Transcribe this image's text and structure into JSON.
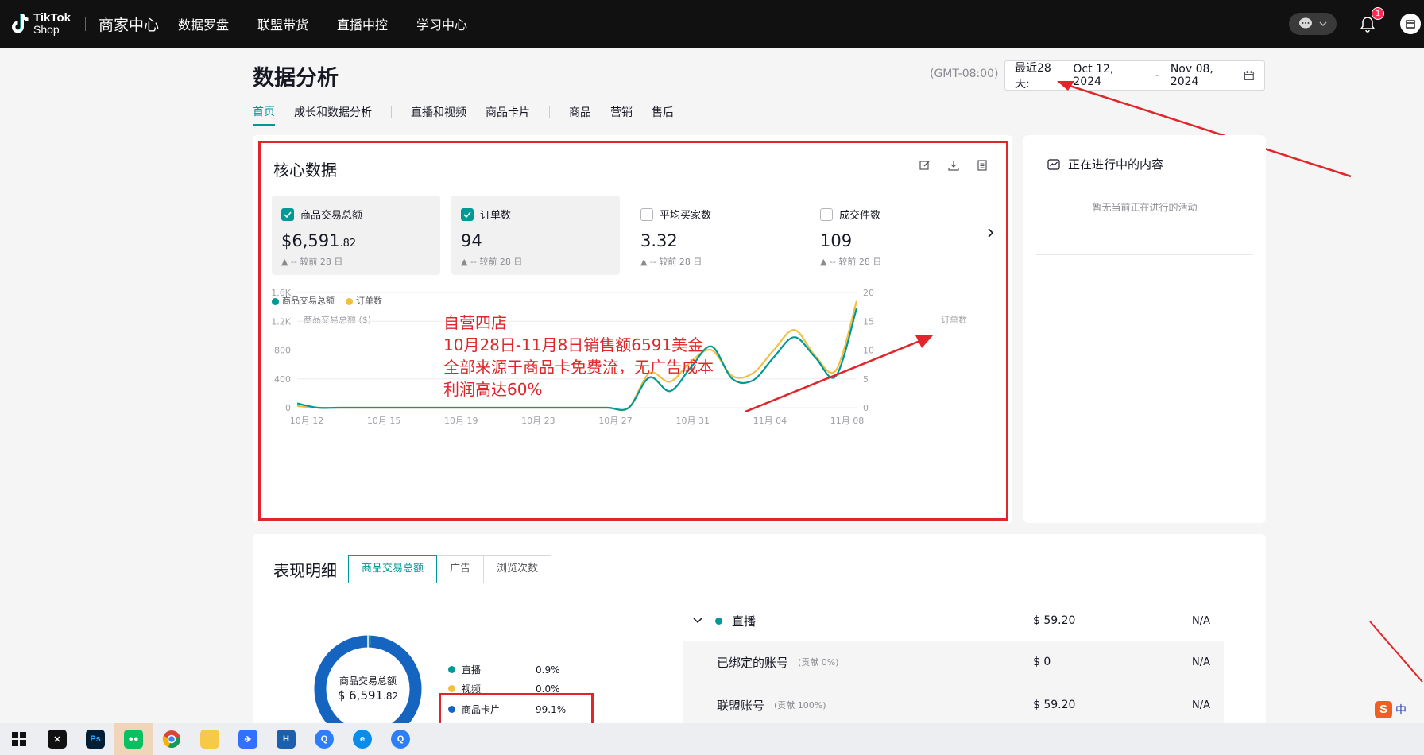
{
  "topbar": {
    "logo_line1": "TikTok",
    "logo_line2": "Shop",
    "title": "商家中心",
    "nav": [
      "数据罗盘",
      "联盟带货",
      "直播中控",
      "学习中心"
    ],
    "notification_count": "1"
  },
  "header": {
    "title": "数据分析",
    "timezone": "(GMT-08:00)",
    "range_label": "最近28天:",
    "date_start": "Oct 12, 2024",
    "date_end": "Nov 08, 2024",
    "date_dash": "-"
  },
  "tabs": [
    "首页",
    "成长和数据分析",
    "直播和视频",
    "商品卡片",
    "商品",
    "营销",
    "售后"
  ],
  "core": {
    "title": "核心数据",
    "metrics": [
      {
        "label": "商品交易总额",
        "prefix": "$",
        "value": "6,591",
        "decimals": ".82",
        "compare": "▲ -- 较前 28 日",
        "checked": true
      },
      {
        "label": "订单数",
        "prefix": "",
        "value": "94",
        "decimals": "",
        "compare": "▲ -- 较前 28 日",
        "checked": true
      },
      {
        "label": "平均买家数",
        "prefix": "",
        "value": "3.32",
        "decimals": "",
        "compare": "▲ -- 较前 28 日",
        "checked": false
      },
      {
        "label": "成交件数",
        "prefix": "",
        "value": "109",
        "decimals": "",
        "compare": "▲ -- 较前 28 日",
        "checked": false
      }
    ],
    "legend": [
      "商品交易总额",
      "订单数"
    ],
    "left_axis_name": "商品交易总额 ($)",
    "right_axis_name": "订单数"
  },
  "annotation": {
    "lines": [
      "自营四店",
      "10月28日-11月8日销售额6591美金",
      "全部来源于商品卡免费流，无广告成本",
      "利润高达60%"
    ]
  },
  "chart_data": {
    "type": "line",
    "x_ticks": [
      "10月 12",
      "10月 15",
      "10月 19",
      "10月 23",
      "10月 27",
      "10月 31",
      "11月 04",
      "11月 08"
    ],
    "y_left_ticks": [
      "0",
      "400",
      "800",
      "1.2K",
      "1.6K"
    ],
    "y_right_ticks": [
      "0",
      "5",
      "10",
      "15",
      "20"
    ],
    "ylim_left": [
      0,
      1600
    ],
    "ylim_right": [
      0,
      20
    ],
    "x_dates": [
      "10-12",
      "10-13",
      "10-14",
      "10-15",
      "10-16",
      "10-17",
      "10-18",
      "10-19",
      "10-20",
      "10-21",
      "10-22",
      "10-23",
      "10-24",
      "10-25",
      "10-26",
      "10-27",
      "10-28",
      "10-29",
      "10-30",
      "10-31",
      "11-01",
      "11-02",
      "11-03",
      "11-04",
      "11-05",
      "11-06",
      "11-07",
      "11-08"
    ],
    "series": [
      {
        "name": "商品交易总额",
        "axis": "left",
        "color": "#009995",
        "values": [
          60,
          0,
          0,
          0,
          0,
          0,
          0,
          0,
          0,
          0,
          0,
          0,
          0,
          0,
          0,
          0,
          0,
          420,
          230,
          560,
          850,
          400,
          380,
          700,
          980,
          700,
          440,
          1380
        ]
      },
      {
        "name": "订单数",
        "axis": "right",
        "color": "#f0c040",
        "values": [
          0.3,
          0,
          0,
          0,
          0,
          0,
          0,
          0,
          0,
          0,
          0,
          0,
          0,
          0,
          0,
          0,
          0,
          6,
          4.5,
          8,
          10,
          5.5,
          6,
          10,
          13.5,
          9,
          6.5,
          18.5
        ]
      }
    ]
  },
  "side": {
    "title": "正在进行中的内容",
    "empty": "暂无当前正在进行的活动"
  },
  "detail": {
    "title": "表现明细",
    "segments": [
      "商品交易总额",
      "广告",
      "浏览次数"
    ],
    "donut_label": "商品交易总额",
    "donut_prefix": "$",
    "donut_value": "6,591",
    "donut_decimals": ".82",
    "breakdown": [
      {
        "name": "直播",
        "pct": "0.9%",
        "color": "#009995",
        "share": 0.009
      },
      {
        "name": "视频",
        "pct": "0.0%",
        "color": "#f0c040",
        "share": 0.0
      },
      {
        "name": "商品卡片",
        "pct": "99.1%",
        "color": "#1565c0",
        "share": 0.991
      }
    ],
    "rows": [
      {
        "name": "直播",
        "contrib": "",
        "amount": "$ 59.20",
        "na": "N/A"
      },
      {
        "name": "已绑定的账号",
        "contrib": "(贡献 0%)",
        "amount": "$ 0",
        "na": "N/A"
      },
      {
        "name": "联盟账号",
        "contrib": "(贡献 100%)",
        "amount": "$ 59.20",
        "na": "N/A"
      }
    ]
  },
  "taskbar": {
    "apps": [
      "windows-start",
      "capcut",
      "photoshop",
      "wechat",
      "chrome",
      "file-explorer",
      "feishu",
      "huke",
      "qq-browser",
      "edge",
      "qq-browser-2"
    ]
  },
  "ime": {
    "label": "中"
  }
}
